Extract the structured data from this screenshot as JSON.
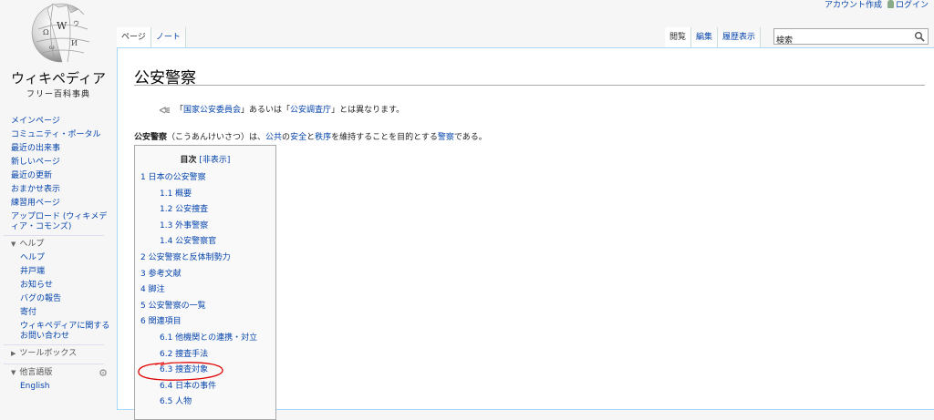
{
  "personal": {
    "create_account": "アカウント作成",
    "login": "ログイン"
  },
  "logo": {
    "title": "ウィキペディア",
    "subtitle": "フリー百科事典"
  },
  "sidebar": {
    "nav": [
      "メインページ",
      "コミュニティ・ポータル",
      "最近の出来事",
      "新しいページ",
      "最近の更新",
      "おまかせ表示",
      "練習用ページ",
      "アップロード (ウィキメディア・コモンズ)"
    ],
    "help_heading": "ヘルプ",
    "help_items": [
      "ヘルプ",
      "井戸端",
      "お知らせ",
      "バグの報告",
      "寄付",
      "ウィキペディアに関するお問い合わせ"
    ],
    "toolbox_heading": "ツールボックス",
    "lang_heading": "他言語版",
    "lang_items": [
      "English"
    ]
  },
  "tabs": {
    "left": [
      "ページ",
      "ノート"
    ],
    "right": [
      "閲覧",
      "編集",
      "履歴表示"
    ]
  },
  "search": {
    "value": "検索"
  },
  "article": {
    "title": "公安警察",
    "hatnote": {
      "q1": "「",
      "link1": "国家公安委員会",
      "q2": "」あるいは「",
      "link2": "公安調査庁",
      "q3": "」とは異なります。"
    },
    "intro": {
      "term": "公安警察",
      "reading": "（こうあんけいさつ）は、",
      "l1": "公共",
      "t1": "の",
      "l2": "安全",
      "t2": "と",
      "l3": "秩序",
      "t3": "を維持することを目的とする",
      "l4": "警察",
      "t4": "である。"
    }
  },
  "toc": {
    "title": "目次",
    "toggle": "[非表示]",
    "items": [
      "1 日本の公安警察",
      "1.1 概要",
      "1.2 公安捜査",
      "1.3 外事警察",
      "1.4 公安警察官",
      "2 公安警察と反体制勢力",
      "3 参考文献",
      "4 脚注",
      "5 公安警察の一覧",
      "6 関連項目",
      "6.1 他機関との連携・対立",
      "6.2 捜査手法",
      "6.3 捜査対象",
      "6.4 日本の事件",
      "6.5 人物"
    ]
  },
  "colors": {
    "link": "#0645ad",
    "annotation": "#e00000"
  }
}
